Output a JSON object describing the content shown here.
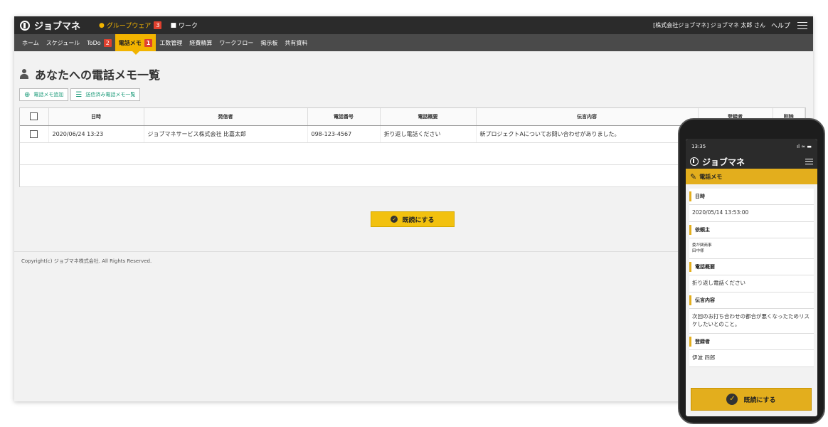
{
  "app": {
    "brand": "ジョブマネ",
    "switches": [
      {
        "label": "グループウェア",
        "badge": "3",
        "active": true
      },
      {
        "label": "ワーク",
        "badge": "",
        "active": false
      }
    ],
    "user": "[株式会社ジョブマネ] ジョブマネ 太郎 さん",
    "help": "ヘルプ"
  },
  "nav": [
    {
      "label": "ホーム",
      "badge": ""
    },
    {
      "label": "スケジュール",
      "badge": ""
    },
    {
      "label": "ToDo",
      "badge": "2"
    },
    {
      "label": "電話メモ",
      "badge": "1",
      "active": true
    },
    {
      "label": "工数管理",
      "badge": ""
    },
    {
      "label": "経費精算",
      "badge": ""
    },
    {
      "label": "ワークフロー",
      "badge": ""
    },
    {
      "label": "掲示板",
      "badge": ""
    },
    {
      "label": "共有資料",
      "badge": ""
    }
  ],
  "page": {
    "title": "あなたへの電話メモ一覧",
    "add_button": "電話メモ追加",
    "sent_list_button": "送信済み電話メモ一覧",
    "mark_read_button": "既読にする"
  },
  "table": {
    "headers": [
      "日時",
      "発信者",
      "電話番号",
      "電話概要",
      "伝言内容",
      "登録者",
      "削除"
    ],
    "rows": [
      {
        "datetime": "2020/06/24 13:23",
        "caller": "ジョブマネサービス株式会社 比嘉太郎",
        "phone": "098-123-4567",
        "summary": "折り返し電話ください",
        "message": "新プロジェクトAについてお問い合わせがありました。"
      }
    ]
  },
  "footer": "Copyright(c) ジョブマネ株式会社. All Rights Reserved.",
  "mobile": {
    "time": "13:35",
    "signal": "ıl ≈ ▬",
    "brand": "ジョブマネ",
    "title": "電話メモ",
    "fields": [
      {
        "label": "日時",
        "value": "2020/05/14 13:53:00"
      },
      {
        "label": "依頼主",
        "value": "委が関商事\n田中様",
        "small": true
      },
      {
        "label": "電話概要",
        "value": "折り返し電話ください"
      },
      {
        "label": "伝言内容",
        "value": "次回のお打ち合わせの都合が悪くなったためリスケしたいとのこと。"
      },
      {
        "label": "登録者",
        "value": "伊波 四郎"
      }
    ],
    "button": "既読にする"
  }
}
